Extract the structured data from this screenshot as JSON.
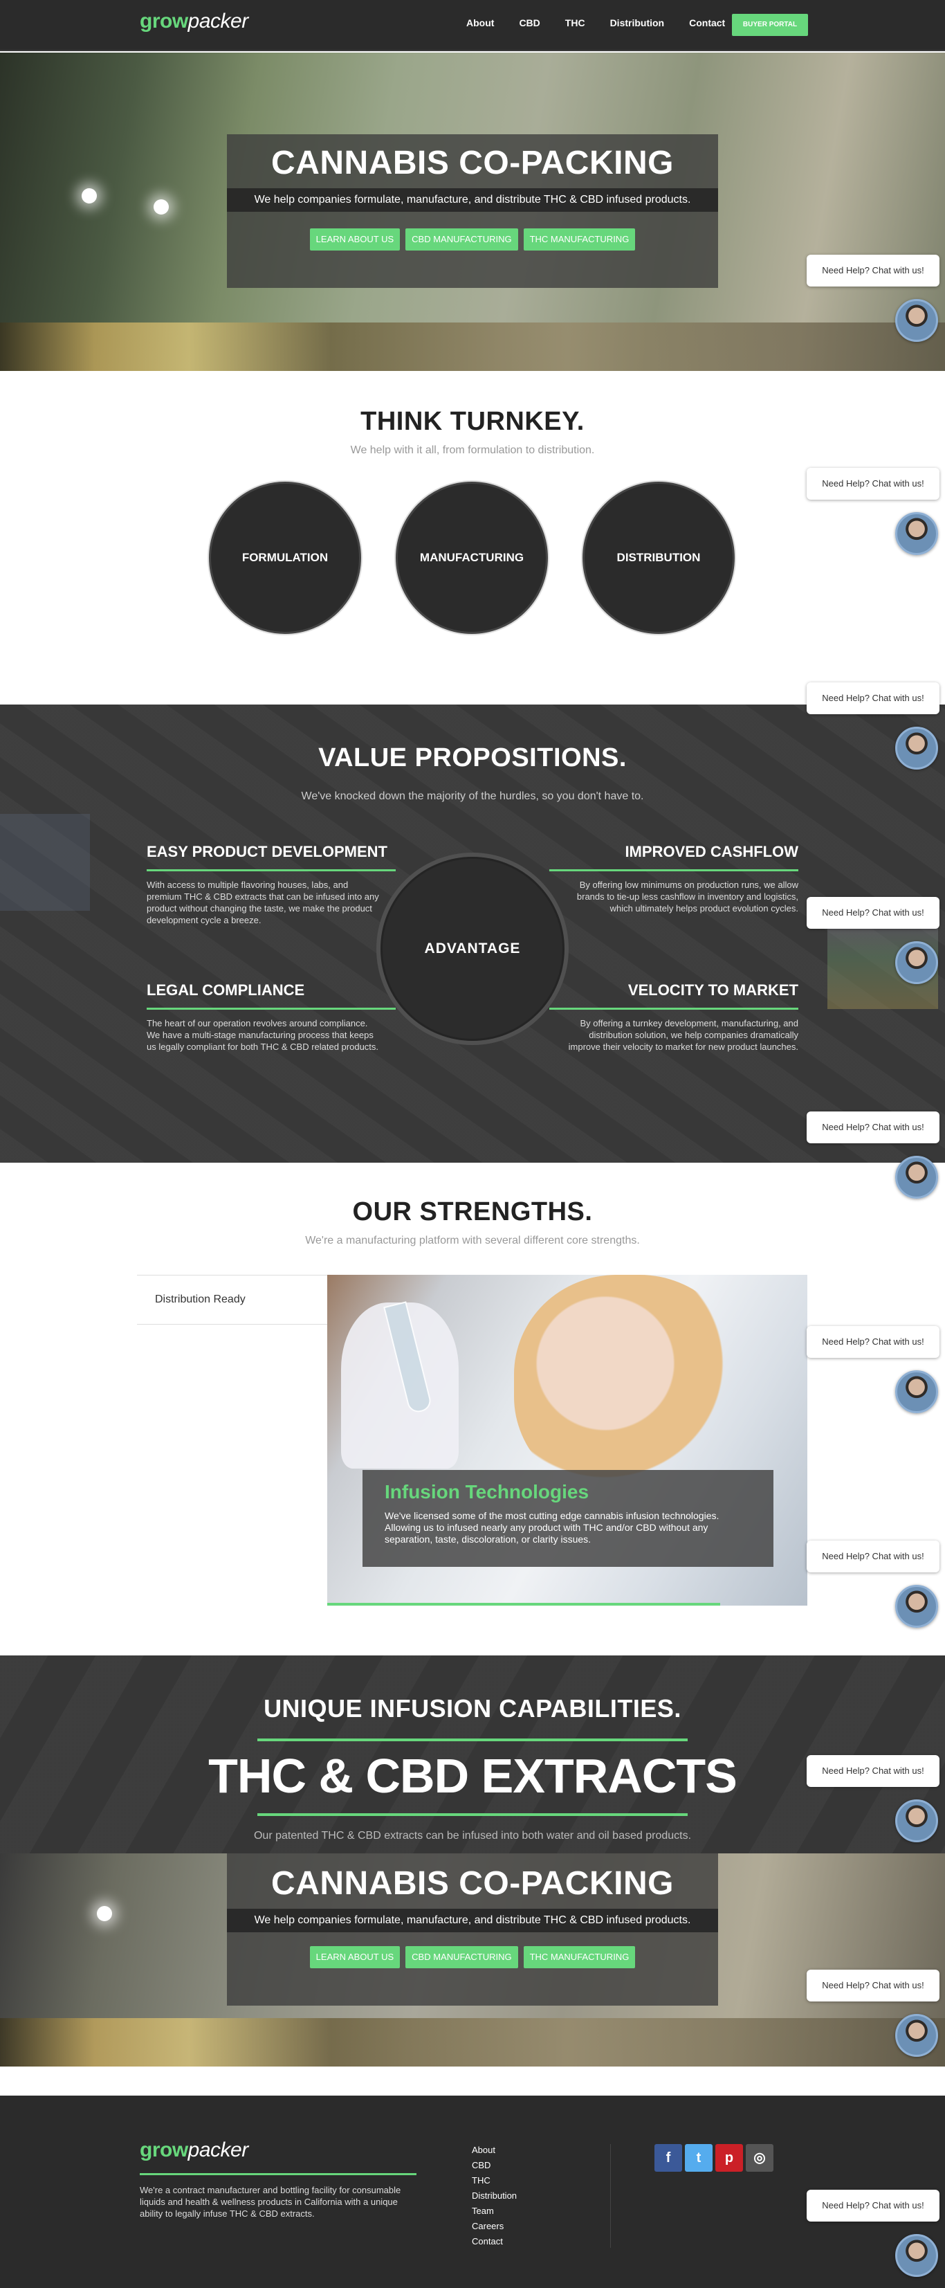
{
  "header": {
    "logo_grow": "grow",
    "logo_packer": "packer",
    "nav": [
      "About",
      "CBD",
      "THC",
      "Distribution",
      "Contact"
    ],
    "buyer_portal": "BUYER PORTAL"
  },
  "hero": {
    "title": "CANNABIS CO-PACKING",
    "subtitle": "We help companies formulate, manufacture, and distribute THC & CBD infused products.",
    "buttons": [
      "LEARN ABOUT US",
      "CBD MANUFACTURING",
      "THC MANUFACTURING"
    ]
  },
  "chat": {
    "label": "Need Help? Chat with us!"
  },
  "turnkey": {
    "title": "THINK TURNKEY.",
    "subtitle": "We help with it all, from formulation to distribution.",
    "circles": [
      "FORMULATION",
      "MANUFACTURING",
      "DISTRIBUTION"
    ]
  },
  "value": {
    "title": "VALUE PROPOSITIONS.",
    "subtitle": "We've knocked down the majority of the hurdles, so you don't have to.",
    "center": "ADVANTAGE",
    "items": [
      {
        "title": "EASY PRODUCT DEVELOPMENT",
        "text": "With access to multiple flavoring houses, labs, and premium THC & CBD extracts that can be infused into any product without changing the taste, we make the product development cycle a breeze."
      },
      {
        "title": "IMPROVED CASHFLOW",
        "text": "By offering low minimums on production runs, we allow brands to tie-up less cashflow in inventory and logistics, which ultimately helps product evolution cycles."
      },
      {
        "title": "LEGAL COMPLIANCE",
        "text": "The heart of our operation revolves around compliance. We have a multi-stage manufacturing process that keeps us legally compliant for both THC & CBD related products."
      },
      {
        "title": "VELOCITY TO MARKET",
        "text": "By offering a turnkey development, manufacturing, and distribution solution, we help companies dramatically improve their velocity to market for new product launches."
      }
    ]
  },
  "strengths": {
    "title": "OUR STRENGTHS.",
    "subtitle": "We're a manufacturing platform with several different core strengths.",
    "tab": "Distribution Ready",
    "feature_title": "Infusion Technologies",
    "feature_text": "We've licensed some of the most cutting edge cannabis infusion technologies. Allowing us to infused nearly any product with THC and/or CBD without any separation, taste, discoloration, or clarity issues."
  },
  "extracts": {
    "kicker": "UNIQUE INFUSION CAPABILITIES.",
    "headline": "THC & CBD EXTRACTS",
    "subtitle": "Our patented THC & CBD extracts can be infused into both water and oil based products."
  },
  "footer": {
    "description": "We're a contract manufacturer and bottling facility for consumable liquids and health & wellness products in California with a unique ability to legally infuse THC & CBD extracts.",
    "links": [
      "About",
      "CBD",
      "THC",
      "Distribution",
      "Team",
      "Careers",
      "Contact"
    ],
    "social": [
      {
        "icon": "facebook-icon",
        "glyph": "f",
        "color": "#3b5998"
      },
      {
        "icon": "twitter-icon",
        "glyph": "t",
        "color": "#55acee"
      },
      {
        "icon": "pinterest-icon",
        "glyph": "p",
        "color": "#cb2027"
      },
      {
        "icon": "instagram-icon",
        "glyph": "◎",
        "color": "#555555"
      }
    ]
  },
  "colors": {
    "accent": "#67d77c",
    "dark": "#2b2b2b"
  }
}
